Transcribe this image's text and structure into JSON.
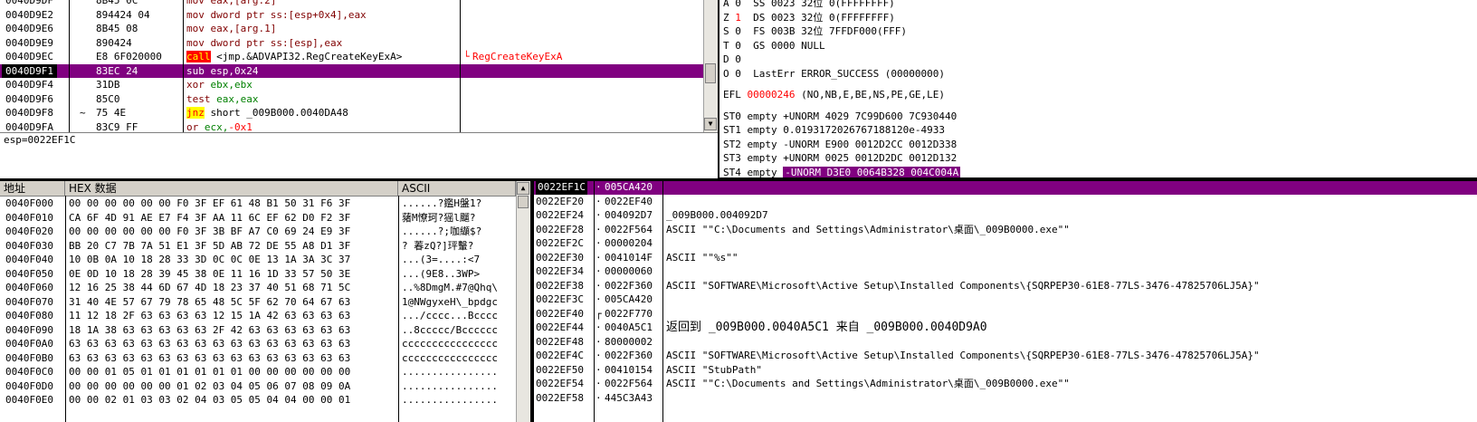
{
  "disasm": {
    "rows": [
      {
        "addr": "0040D9E2",
        "hex": "894424 04",
        "arrow": "",
        "ins": [
          {
            "t": "mov",
            "c": "mn"
          },
          {
            "t": " dword ptr ss:[esp+0x4],eax",
            "c": "mn"
          }
        ],
        "comment": ""
      },
      {
        "addr": "0040D9E6",
        "hex": "8B45 08",
        "arrow": "",
        "ins": [
          {
            "t": "mov",
            "c": "mn"
          },
          {
            "t": " eax,[arg.1]",
            "c": "mn"
          }
        ],
        "comment": ""
      },
      {
        "addr": "0040D9E9",
        "hex": "890424",
        "arrow": "",
        "ins": [
          {
            "t": "mov",
            "c": "mn"
          },
          {
            "t": " dword ptr ss:[esp],eax",
            "c": "mn"
          }
        ],
        "comment": ""
      },
      {
        "addr": "0040D9EC",
        "hex": "E8 6F020000",
        "arrow": "",
        "ins": [
          {
            "t": "call",
            "c": "k-call"
          },
          {
            "t": " <jmp.&ADVAPI32.RegCreateKeyExA>",
            "c": ""
          }
        ],
        "comment": "RegCreateKeyExA"
      },
      {
        "addr": "0040D9F1",
        "hex": "83EC 24",
        "arrow": "",
        "ins": [
          {
            "t": "sub",
            "c": "mn"
          },
          {
            "t": " esp,",
            "c": "reg"
          },
          {
            "t": "0x24",
            "c": "imm"
          }
        ],
        "comment": "",
        "selected": true
      },
      {
        "addr": "0040D9F4",
        "hex": "31DB",
        "arrow": "",
        "ins": [
          {
            "t": "xor",
            "c": "mn"
          },
          {
            "t": " ebx,ebx",
            "c": "reg"
          }
        ],
        "comment": ""
      },
      {
        "addr": "0040D9F6",
        "hex": "85C0",
        "arrow": "",
        "ins": [
          {
            "t": "test",
            "c": "mn"
          },
          {
            "t": " eax,eax",
            "c": "reg"
          }
        ],
        "comment": ""
      },
      {
        "addr": "0040D9F8",
        "hex": "75 4E",
        "arrow": "~",
        "ins": [
          {
            "t": "jnz",
            "c": "k-jnz"
          },
          {
            "t": " short _009B000.0040DA48",
            "c": ""
          }
        ],
        "comment": ""
      },
      {
        "addr": "0040D9FA",
        "hex": "83C9 FF",
        "arrow": "",
        "ins": [
          {
            "t": "or",
            "c": "mn"
          },
          {
            "t": " ecx,",
            "c": "reg"
          },
          {
            "t": "-0x1",
            "c": "imm"
          }
        ],
        "comment": ""
      }
    ],
    "top_partial": {
      "addr": "0040D9DF",
      "hex": "8B45 0C",
      "ins": "mov eax,[arg.2]"
    },
    "info": "esp=0022EF1C"
  },
  "registers": {
    "flags": [
      {
        "text": "A 0  SS 0023 32位 0(FFFFFFFF)"
      },
      {
        "pre": "Z ",
        "val": "1",
        "post": "  DS 0023 32位 0(FFFFFFFF)"
      },
      {
        "text": "S 0  FS 003B 32位 7FFDF000(FFF)"
      },
      {
        "text": "T 0  GS 0000 NULL"
      },
      {
        "text": "D 0"
      },
      {
        "text": "O 0  LastErr ERROR_SUCCESS (00000000)"
      }
    ],
    "efl_label": "EFL",
    "efl_value": "00000246",
    "efl_desc": " (NO,NB,E,BE,NS,PE,GE,LE)",
    "fpu": [
      "ST0 empty +UNORM 4029 7C99D600 7C930440",
      "ST1 empty 0.0193172026767188120e-4933",
      "ST2 empty -UNORM E900 0012D2CC 0012D338",
      "ST3 empty +UNORM 0025 0012D2DC 0012D132"
    ],
    "fpu_last_label": "ST4 empty ",
    "fpu_last_hl": "-UNORM D3E0 0064B328 004C004A"
  },
  "dump": {
    "headers": {
      "addr": "地址",
      "hex": "HEX 数据",
      "ascii": "ASCII"
    },
    "rows": [
      {
        "addr": "0040F000",
        "hex": "00 00 00 00 00 00 F0 3F EF 61 48 B1 50 31 F6 3F",
        "ascii": "......?鑑H盤1?"
      },
      {
        "addr": "0040F010",
        "hex": "CA 6F 4D 91 AE E7 F4 3F AA 11 6C EF 62 D0 F2 3F",
        "ascii": "蕏M憭珂?猺l飀?"
      },
      {
        "addr": "0040F020",
        "hex": "00 00 00 00 00 00 F0 3F 3B BF A7 C0 69 24 E9 3F",
        "ascii": "......?;咖纈$?"
      },
      {
        "addr": "0040F030",
        "hex": "BB 20 C7 7B 7A 51 E1 3F 5D AB 72 DE 55 A8 D1 3F",
        "ascii": "? 萶zQ?]玶轚?"
      },
      {
        "addr": "0040F040",
        "hex": "10 0B 0A 10 18 28 33 3D 0C 0C 0E 13 1A 3A 3C 37",
        "ascii": "...(3=....:<7"
      },
      {
        "addr": "0040F050",
        "hex": "0E 0D 10 18 28 39 45 38 0E 11 16 1D 33 57 50 3E",
        "ascii": "...(9E8..3WP>"
      },
      {
        "addr": "0040F060",
        "hex": "12 16 25 38 44 6D 67 4D 18 23 37 40 51 68 71 5C",
        "ascii": "..%8DmgM.#7@Qhq\\"
      },
      {
        "addr": "0040F070",
        "hex": "31 40 4E 57 67 79 78 65 48 5C 5F 62 70 64 67 63",
        "ascii": "1@NWgyxeH\\_bpdgc"
      },
      {
        "addr": "0040F080",
        "hex": "11 12 18 2F 63 63 63 63 12 15 1A 42 63 63 63 63",
        "ascii": ".../cccc...Bcccc"
      },
      {
        "addr": "0040F090",
        "hex": "18 1A 38 63 63 63 63 63 2F 42 63 63 63 63 63 63",
        "ascii": "..8ccccc/Bcccccc"
      },
      {
        "addr": "0040F0A0",
        "hex": "63 63 63 63 63 63 63 63 63 63 63 63 63 63 63 63",
        "ascii": "cccccccccccccccc"
      },
      {
        "addr": "0040F0B0",
        "hex": "63 63 63 63 63 63 63 63 63 63 63 63 63 63 63 63",
        "ascii": "cccccccccccccccc"
      },
      {
        "addr": "0040F0C0",
        "hex": "00 00 01 05 01 01 01 01 01 01 00 00 00 00 00 00",
        "ascii": "................"
      },
      {
        "addr": "0040F0D0",
        "hex": "00 00 00 00 00 00 01 02 03 04 05 06 07 08 09 0A",
        "ascii": "................"
      },
      {
        "addr": "0040F0E0",
        "hex": "00 00 02 01 03 03 02 04 03 05 05 04 04 00 00 01",
        "ascii": "................"
      }
    ]
  },
  "stack": {
    "rows": [
      {
        "addr": "0022EF1C",
        "val": "005CA420",
        "comment": "",
        "selected": true
      },
      {
        "addr": "0022EF20",
        "val": "0022EF40",
        "comment": ""
      },
      {
        "addr": "0022EF24",
        "val": "004092D7",
        "comment": "_009B000.004092D7"
      },
      {
        "addr": "0022EF28",
        "val": "0022F564",
        "comment": "ASCII \"\"C:\\Documents and Settings\\Administrator\\桌面\\_009B0000.exe\"\""
      },
      {
        "addr": "0022EF2C",
        "val": "00000204",
        "comment": ""
      },
      {
        "addr": "0022EF30",
        "val": "0041014F",
        "comment": "ASCII \"\"%s\"\""
      },
      {
        "addr": "0022EF34",
        "val": "00000060",
        "comment": ""
      },
      {
        "addr": "0022EF38",
        "val": "0022F360",
        "comment": "ASCII \"SOFTWARE\\Microsoft\\Active Setup\\Installed Components\\{SQRPEP30-61E8-77LS-3476-47825706LJ5A}\""
      },
      {
        "addr": "0022EF3C",
        "val": "005CA420",
        "comment": ""
      },
      {
        "addr": "0022EF40",
        "val": "0022F770",
        "comment": "",
        "frame": true
      },
      {
        "addr": "0022EF44",
        "val": "0040A5C1",
        "comment": "返回到 _009B000.0040A5C1 来自 _009B000.0040D9A0",
        "big": true
      },
      {
        "addr": "0022EF48",
        "val": "80000002",
        "comment": ""
      },
      {
        "addr": "0022EF4C",
        "val": "0022F360",
        "comment": "ASCII \"SOFTWARE\\Microsoft\\Active Setup\\Installed Components\\{SQRPEP30-61E8-77LS-3476-47825706LJ5A}\""
      },
      {
        "addr": "0022EF50",
        "val": "00410154",
        "comment": "ASCII \"StubPath\""
      },
      {
        "addr": "0022EF54",
        "val": "0022F564",
        "comment": "ASCII \"\"C:\\Documents and Settings\\Administrator\\桌面\\_009B0000.exe\"\""
      },
      {
        "addr": "0022EF58",
        "val": "445C3A43",
        "comment": ""
      }
    ]
  }
}
